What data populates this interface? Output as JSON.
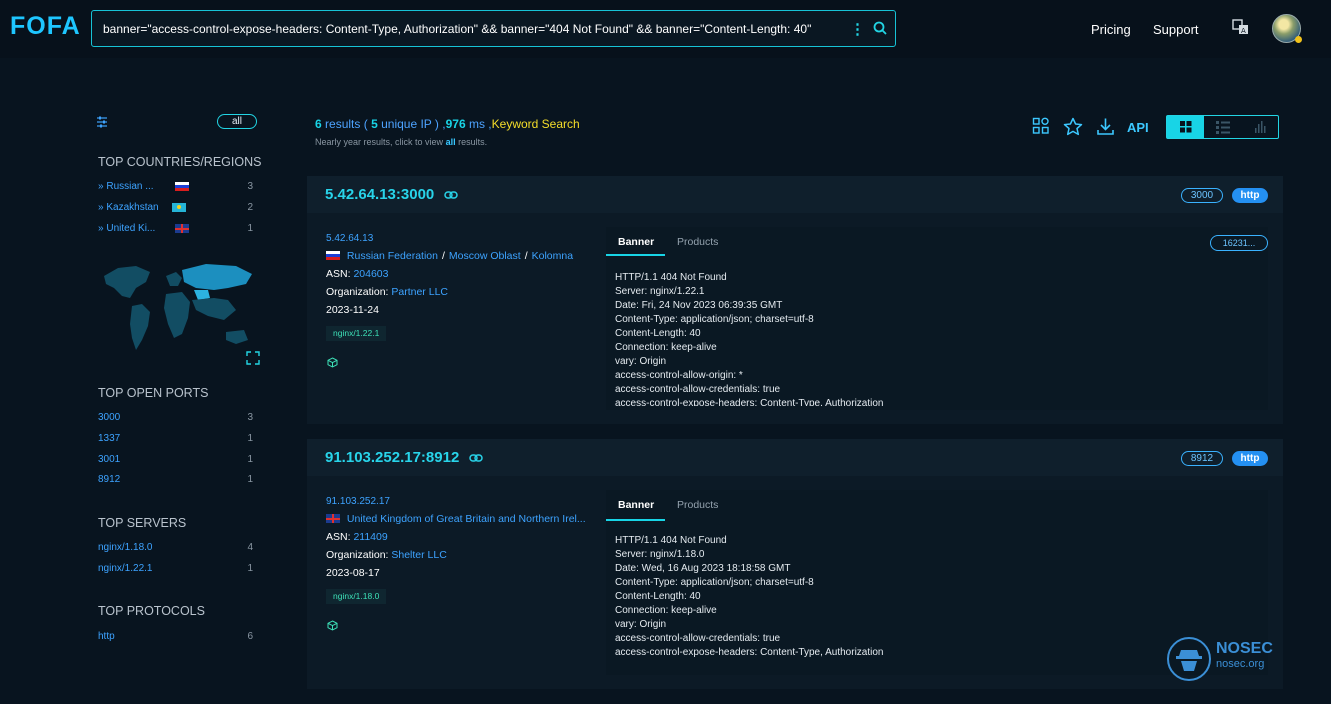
{
  "header": {
    "logo": "FOFA",
    "query": "banner=\"access-control-expose-headers: Content-Type, Authorization\" && banner=\"404 Not Found\" && banner=\"Content-Length: 40\"",
    "more_icon": "⋮",
    "nav_pricing": "Pricing",
    "nav_support": "Support"
  },
  "sidebar": {
    "all_label": "all",
    "countries_title": "TOP COUNTRIES/REGIONS",
    "countries": [
      {
        "label": "Russian ...",
        "count": "3"
      },
      {
        "label": "Kazakhstan",
        "count": "2"
      },
      {
        "label": "United Ki...",
        "count": "1"
      }
    ],
    "ports_title": "TOP OPEN PORTS",
    "ports": [
      {
        "label": "3000",
        "count": "3"
      },
      {
        "label": "1337",
        "count": "1"
      },
      {
        "label": "3001",
        "count": "1"
      },
      {
        "label": "8912",
        "count": "1"
      }
    ],
    "servers_title": "TOP SERVERS",
    "servers": [
      {
        "label": "nginx/1.18.0",
        "count": "4"
      },
      {
        "label": "nginx/1.22.1",
        "count": "1"
      }
    ],
    "protocols_title": "TOP PROTOCOLS",
    "protocols": [
      {
        "label": "http",
        "count": "6"
      }
    ]
  },
  "results": {
    "count": "6",
    "results_word": "results (",
    "unique": "5",
    "unique_word": "unique IP ) ,",
    "ms": "976",
    "ms_word": "ms ,",
    "keyword": "Keyword Search",
    "sub_prefix": "Nearly year results, click to view",
    "sub_all": "all",
    "sub_suffix": "results.",
    "api_label": "API",
    "accent": "#18d4e6"
  },
  "cards": [
    {
      "title": "5.42.64.13:3000",
      "port": "3000",
      "protocol": "http",
      "ip": "5.42.64.13",
      "country": "Russian Federation",
      "region": "Moscow Oblast",
      "city": "Kolomna",
      "asn_label": "ASN:",
      "asn": "204603",
      "org_label": "Organization:",
      "org": "Partner LLC",
      "date": "2023-11-24",
      "server": "nginx/1.22.1",
      "tab_banner": "Banner",
      "tab_products": "Products",
      "hash": "16231...",
      "banner": "HTTP/1.1 404 Not Found\nServer: nginx/1.22.1\nDate: Fri, 24 Nov 2023 06:39:35 GMT\nContent-Type: application/json; charset=utf-8\nContent-Length: 40\nConnection: keep-alive\nvary: Origin\naccess-control-allow-origin: *\naccess-control-allow-credentials: true\naccess-control-expose-headers: Content-Type, Authorization"
    },
    {
      "title": "91.103.252.17:8912",
      "port": "8912",
      "protocol": "http",
      "ip": "91.103.252.17",
      "country": "United Kingdom of Great Britain and Northern Irel...",
      "asn_label": "ASN:",
      "asn": "211409",
      "org_label": "Organization:",
      "org": "Shelter LLC",
      "date": "2023-08-17",
      "server": "nginx/1.18.0",
      "tab_banner": "Banner",
      "tab_products": "Products",
      "banner": "HTTP/1.1 404 Not Found\nServer: nginx/1.18.0\nDate: Wed, 16 Aug 2023 18:18:58 GMT\nContent-Type: application/json; charset=utf-8\nContent-Length: 40\nConnection: keep-alive\nvary: Origin\naccess-control-allow-credentials: true\naccess-control-expose-headers: Content-Type, Authorization"
    }
  ],
  "watermark": {
    "name": "NOSEC",
    "domain": "nosec.org"
  }
}
